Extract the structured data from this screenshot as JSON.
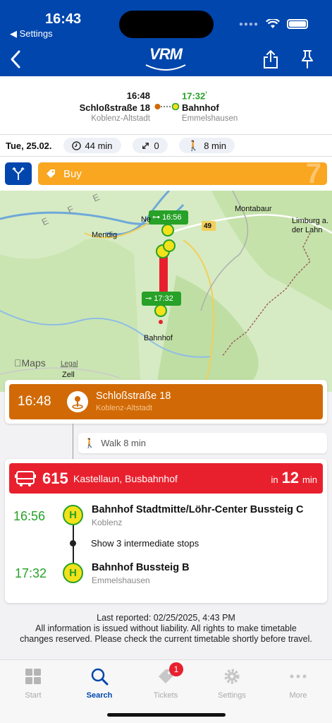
{
  "status": {
    "time": "16:43",
    "back_label": "◀ Settings"
  },
  "header": {
    "logo": "VRM"
  },
  "summary": {
    "departure": {
      "time": "16:48",
      "name": "Schloßstraße 18",
      "area": "Koblenz-Altstadt"
    },
    "arrival": {
      "time": "17:32",
      "name": "Bahnhof",
      "area": "Emmelshausen"
    }
  },
  "info": {
    "date": "Tue, 25.02.",
    "duration": "44 min",
    "transfers": "0",
    "walk": "8 min"
  },
  "actions": {
    "buy_label": "Buy",
    "ghost_digit": "7"
  },
  "map": {
    "labels": {
      "montabaur": "Montabaur",
      "limburg": "Limburg a.",
      "lahn": "der Lahn",
      "mendig": "Mendig",
      "ne": "Ne",
      "bahnhof": "Bahnhof",
      "zell": "Zell",
      "road49": "49",
      "eifel": "E F E R",
      "apple_maps": "Maps",
      "legal": "Legal"
    },
    "tag_dep": "16:56",
    "tag_arr": "17:32"
  },
  "start_card": {
    "time": "16:48",
    "name": "Schloßstraße 18",
    "area": "Koblenz-Altstadt"
  },
  "walk": {
    "label": "Walk 8 min"
  },
  "trip": {
    "line": "615",
    "direction": "Kastellaun, Busbahnhof",
    "in_prefix": "in",
    "in_value": "12",
    "in_unit": "min",
    "stops": [
      {
        "time": "16:56",
        "name": "Bahnhof Stadtmitte/Löhr-Center Bussteig C",
        "area": "Koblenz"
      },
      {
        "time": "17:32",
        "name": "Bahnhof Bussteig B",
        "area": "Emmelshausen"
      }
    ],
    "intermediate": "Show 3 intermediate stops",
    "h_glyph": "H"
  },
  "footer": {
    "line1": "Last reported: 02/25/2025, 4:43 PM",
    "line2": "All information is issued without liability. All rights to make timetable",
    "line3": "changes reserved. Please check the current timetable shortly before travel."
  },
  "tabs": [
    {
      "label": "Start",
      "icon": "grid-icon"
    },
    {
      "label": "Search",
      "icon": "search-icon"
    },
    {
      "label": "Tickets",
      "icon": "ticket-icon",
      "badge": "1"
    },
    {
      "label": "Settings",
      "icon": "gear-icon"
    },
    {
      "label": "More",
      "icon": "more-icon"
    }
  ],
  "colors": {
    "brand": "#0046ad",
    "buy": "#f9a620",
    "start": "#d16a06",
    "line": "#e8202e",
    "realtime": "#27a127"
  }
}
